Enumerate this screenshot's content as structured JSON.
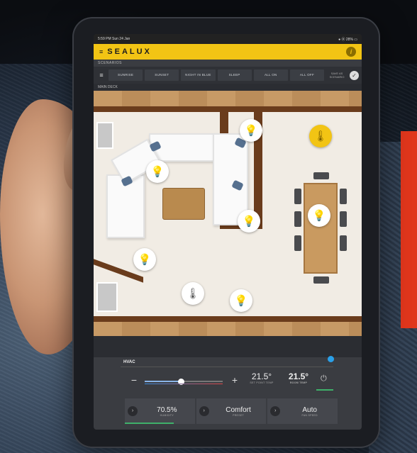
{
  "status_bar": {
    "time": "5:59 PM  Sun 24 Jan",
    "battery": "● ⦿ 28% ▭"
  },
  "app": {
    "brand": "SEALUX",
    "brand_icon": "menu-lines-icon",
    "info": "i"
  },
  "scenarios": {
    "section_label": "SCENARIOS",
    "menu": "≡",
    "buttons": [
      "SUNRISE",
      "SUNSET",
      "NIGHT IN BLUE",
      "SLEEP",
      "ALL ON",
      "ALL OFF"
    ],
    "save_label": "SAVE AS SCENARIO",
    "check": "✓"
  },
  "deck": {
    "label": "MAIN DECK"
  },
  "fixtures": [
    {
      "name": "light",
      "icon": "lightbulb-icon",
      "glyph": "💡"
    },
    {
      "name": "climate",
      "icon": "thermometer-icon",
      "glyph": "🌡"
    },
    {
      "name": "rgb-light",
      "icon": "rgb-bulb-icon",
      "glyph": "💡"
    }
  ],
  "hvac": {
    "title": "HVAC",
    "minus": "−",
    "plus": "+",
    "set_point": {
      "value": "21.5°",
      "caption": "SET POINT TEMP"
    },
    "room": {
      "value": "21.5°",
      "caption": "ROOM TEMP"
    },
    "power": "⏻",
    "slider_level": 0.46,
    "cards": [
      {
        "value": "70.5%",
        "caption": "HUMIDITY",
        "arrow": "›",
        "accent": "#3fb06a"
      },
      {
        "value": "Comfort",
        "caption": "PRESET",
        "arrow": "›",
        "accent": ""
      },
      {
        "value": "Auto",
        "caption": "FAN SPEED",
        "arrow": "›",
        "accent": ""
      }
    ]
  },
  "colors": {
    "accent": "#f2c414",
    "toggle": "#2aa0e8",
    "status_green": "#3fb06a",
    "signage": "#e0361c"
  }
}
